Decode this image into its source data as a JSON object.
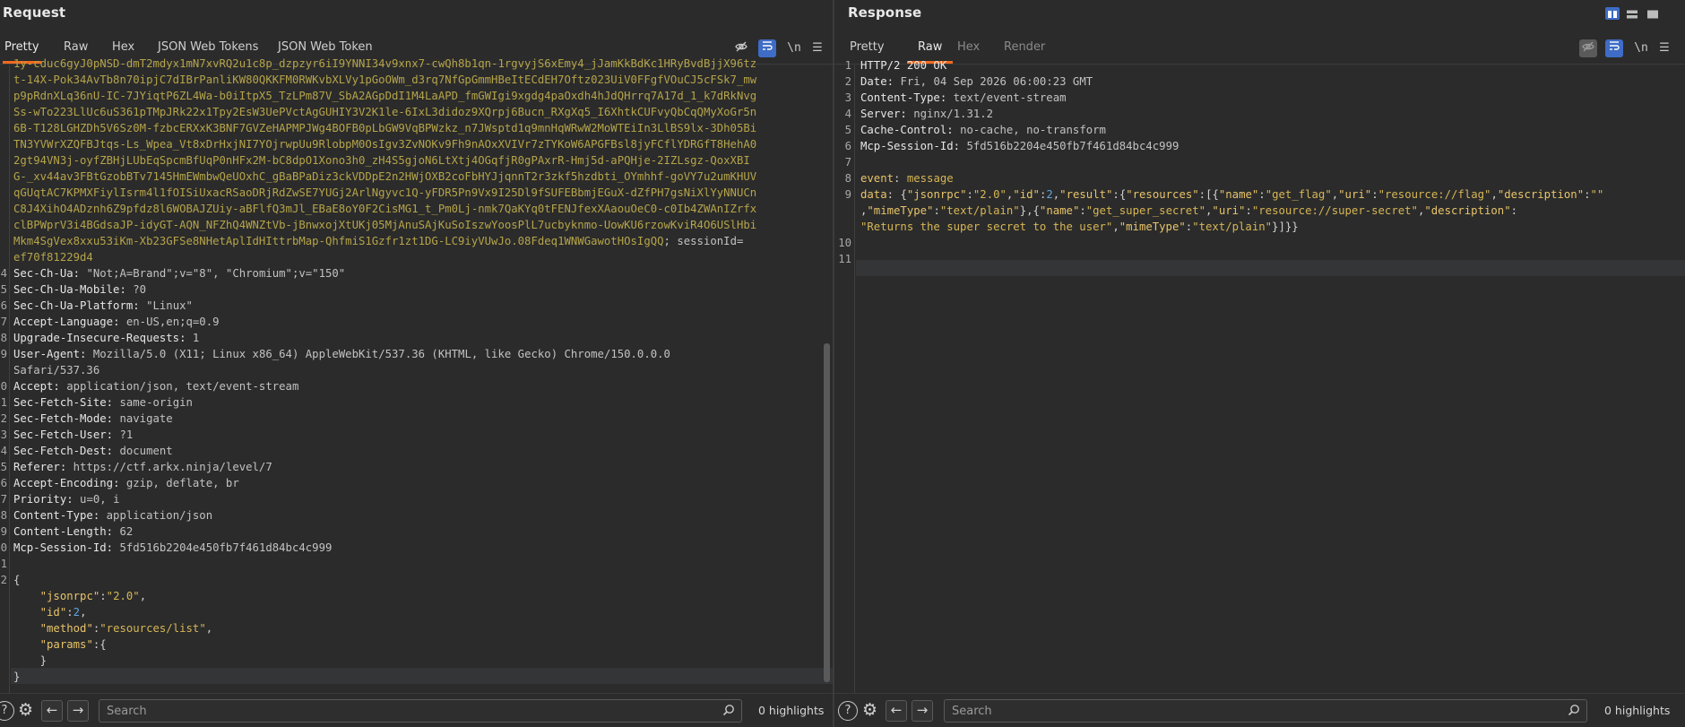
{
  "request": {
    "title": "Request",
    "tabs": [
      "Pretty",
      "Raw",
      "Hex",
      "JSON Web Tokens",
      "JSON Web Token"
    ],
    "active_tab": "Pretty",
    "tools": {
      "hide_icon": "eye-off-icon",
      "wrap_icon": "wrap-lines-icon",
      "newline": "\\n",
      "menu_icon": "hamburger-menu-icon"
    },
    "token_lines": [
      "1y-cduc6gyJ0pNSD-dmT2mdyx1mN7xvRQ2u1c8p_dzpzyr6iI9YNNI34v9xnx7-cwQh8b1qn-1rgvyjS6xEmy4_jJamKkBdKc1HRyBvdBjjX96tz",
      "t-14X-Pok34AvTb8n70ipjC7dIBrPanliKW80QKKFM0RWKvbXLVy1pGoOWm_d3rq7NfGpGmmHBeItECdEH7Oftz023UiV0FFgfVOuCJ5cFSk7_mw",
      "p9pRdnXLq36nU-IC-7JYiqtP6ZL4Wa-b0iItpX5_TzLPm87V_SbA2AGpDdI1M4LaAPD_fmGWIgi9xgdg4paOxdh4hJdQHrrq7A17d_1_k7dRkNvg",
      "Ss-wTo223LlUc6uS361pTMpJRk22x1Tpy2EsW3UePVctAgGUHIY3V2K1le-6IxL3didoz9XQrpj6Bucn_RXgXq5_I6XhtkCUFvyQbCqQMyXoGr5n",
      "6B-T128LGHZDh5V6Sz0M-fzbcERXxK3BNF7GVZeHAPMPJWg4BOFB0pLbGW9VqBPWzkz_n7JWsptd1q9mnHqWRwW2MoWTEiIn3LlBS9lx-3Dh05Bi",
      "TN3YVWrXZQFBJtqs-Ls_Wpea_Vt8xDrHxjNI7YOjrwpUu9RlobpM0OsIgv3ZvNOKv9Fh9nAOxXVIVr7zTYKoW6APGFBsl8jyFCflYDRGfT8HehA0",
      "2gt94VN3j-oyfZBHjLUbEqSpcmBfUqP0nHFx2M-bC8dpO1Xono3h0_zH4S5gjoN6LtXtj4OGqfjR0gPAxrR-Hmj5d-aPQHje-2IZLsgz-QoxXBI",
      "G-_xv44av3FBtGzobBTv7145HmEWmbwQeUOxhC_gBaBPaDiz3ckVDDpE2n2HWjOXB2coFbHYJjqnnT2r3zkf5hzdbti_OYmhhf-goVY7u2umKHUV",
      "qGUqtAC7KPMXFiylIsrm4l1fOISiUxacRSaoDRjRdZwSE7YUGj2ArlNgyvc1Q-yFDR5Pn9Vx9I25Dl9fSUFEBbmjEGuX-dZfPH7gsNiXlYyNNUCn",
      "C8J4XihO4ADznh6Z9pfdz8l6WOBAJZUiy-aBFlfQ3mJl_EBaE8oY0F2CisMG1_t_Pm0Lj-nmk7QaKYq0tFENJfexXAaouOeC0-c0Ib4ZWAnIZrfx",
      "clBPWprV3i4BGdsaJP-idyGT-AQN_NFZhQ4WNZtVb-jBnwxojXtUKj05MjAnuSAjKuSoIszwYoosPlL7ucbyknmo-UowKU6rzowKviR4O6USlHbi",
      "Mkm4SgVex8xxu53iKm-Xb23GFSe8NHetAplIdHIttrbMap-QhfmiS1Gzfr1zt1DG-LC9iyVUwJo.08Fdeq1WNWGawotHOsIgQQ"
    ],
    "token_tail": "; sessionId=",
    "session_tail": "ef70f81229d4",
    "headers": [
      {
        "num": "4",
        "name": "Sec-Ch-Ua",
        "value": "\"Not;A=Brand\";v=\"8\", \"Chromium\";v=\"150\""
      },
      {
        "num": "5",
        "name": "Sec-Ch-Ua-Mobile",
        "value": "?0"
      },
      {
        "num": "6",
        "name": "Sec-Ch-Ua-Platform",
        "value": "\"Linux\""
      },
      {
        "num": "7",
        "name": "Accept-Language",
        "value": "en-US,en;q=0.9"
      },
      {
        "num": "8",
        "name": "Upgrade-Insecure-Requests",
        "value": "1"
      },
      {
        "num": "9",
        "name": "User-Agent",
        "value": "Mozilla/5.0 (X11; Linux x86_64) AppleWebKit/537.36 (KHTML, like Gecko) Chrome/150.0.0.0"
      },
      {
        "num": "",
        "name": "",
        "value": "Safari/537.36"
      },
      {
        "num": "0",
        "name": "Accept",
        "value": "application/json, text/event-stream"
      },
      {
        "num": "1",
        "name": "Sec-Fetch-Site",
        "value": "same-origin"
      },
      {
        "num": "2",
        "name": "Sec-Fetch-Mode",
        "value": "navigate"
      },
      {
        "num": "3",
        "name": "Sec-Fetch-User",
        "value": "?1"
      },
      {
        "num": "4",
        "name": "Sec-Fetch-Dest",
        "value": "document"
      },
      {
        "num": "5",
        "name": "Referer",
        "value": "https://ctf.arkx.ninja/level/7"
      },
      {
        "num": "6",
        "name": "Accept-Encoding",
        "value": "gzip, deflate, br"
      },
      {
        "num": "7",
        "name": "Priority",
        "value": "u=0, i"
      },
      {
        "num": "8",
        "name": "Content-Type",
        "value": "application/json"
      },
      {
        "num": "9",
        "name": "Content-Length",
        "value": "62"
      },
      {
        "num": "0",
        "name": "Mcp-Session-Id",
        "value": "5fd516b2204e450fb7f461d84bc4c999"
      }
    ],
    "body": {
      "open": "{",
      "fields": [
        {
          "key": "\"jsonrpc\"",
          "value": "\"2.0\"",
          "type": "str",
          "trail": ","
        },
        {
          "key": "\"id\"",
          "value": "2",
          "type": "num",
          "trail": ","
        },
        {
          "key": "\"method\"",
          "value": "\"resources/list\"",
          "type": "str",
          "trail": ","
        },
        {
          "key": "\"params\"",
          "value": "{",
          "type": "punct",
          "trail": ""
        }
      ],
      "inner_close": "}",
      "close": "}"
    },
    "body_nums": [
      "1",
      "2"
    ],
    "search_placeholder": "Search",
    "highlights": "0 highlights"
  },
  "response": {
    "title": "Response",
    "tabs": [
      "Pretty",
      "Raw",
      "Hex",
      "Render"
    ],
    "active_tab": "Raw",
    "tools": {
      "hide_icon": "eye-off-icon",
      "wrap_icon": "wrap-lines-icon",
      "newline": "\\n",
      "menu_icon": "hamburger-menu-icon"
    },
    "layout_icons": [
      "split-vertical-icon",
      "split-horizontal-icon",
      "single-pane-icon"
    ],
    "status_line": "HTTP/2 200 OK",
    "headers": [
      {
        "name": "Date",
        "value": "Fri, 04 Sep 2026 06:00:23 GMT"
      },
      {
        "name": "Content-Type",
        "value": "text/event-stream"
      },
      {
        "name": "Server",
        "value": "nginx/1.31.2"
      },
      {
        "name": "Cache-Control",
        "value": "no-cache, no-transform"
      },
      {
        "name": "Mcp-Session-Id",
        "value": "5fd516b2204e450fb7f461d84bc4c999"
      }
    ],
    "event_key": "event",
    "event_value": "message",
    "data_key": "data",
    "data_line1": "{\"jsonrpc\":\"2.0\",\"id\":2,\"result\":{\"resources\":[{\"name\":\"get_flag\",\"uri\":\"resource://flag\",\"description\":\"\"",
    "data_line2": ",\"mimeType\":\"text/plain\"},{\"name\":\"get_super_secret\",\"uri\":\"resource://super-secret\",\"description\":",
    "data_line3": "\"Returns the super secret to the user\",\"mimeType\":\"text/plain\"}]}}",
    "line_numbers": [
      "1",
      "2",
      "3",
      "4",
      "5",
      "6",
      "7",
      "8",
      "9",
      "",
      "",
      "10",
      "11"
    ],
    "search_placeholder": "Search",
    "highlights": "0 highlights"
  },
  "colors": {
    "accent": "#f06a1f",
    "blue_toggle": "#3e6cc6",
    "background": "#2b2b2b"
  }
}
